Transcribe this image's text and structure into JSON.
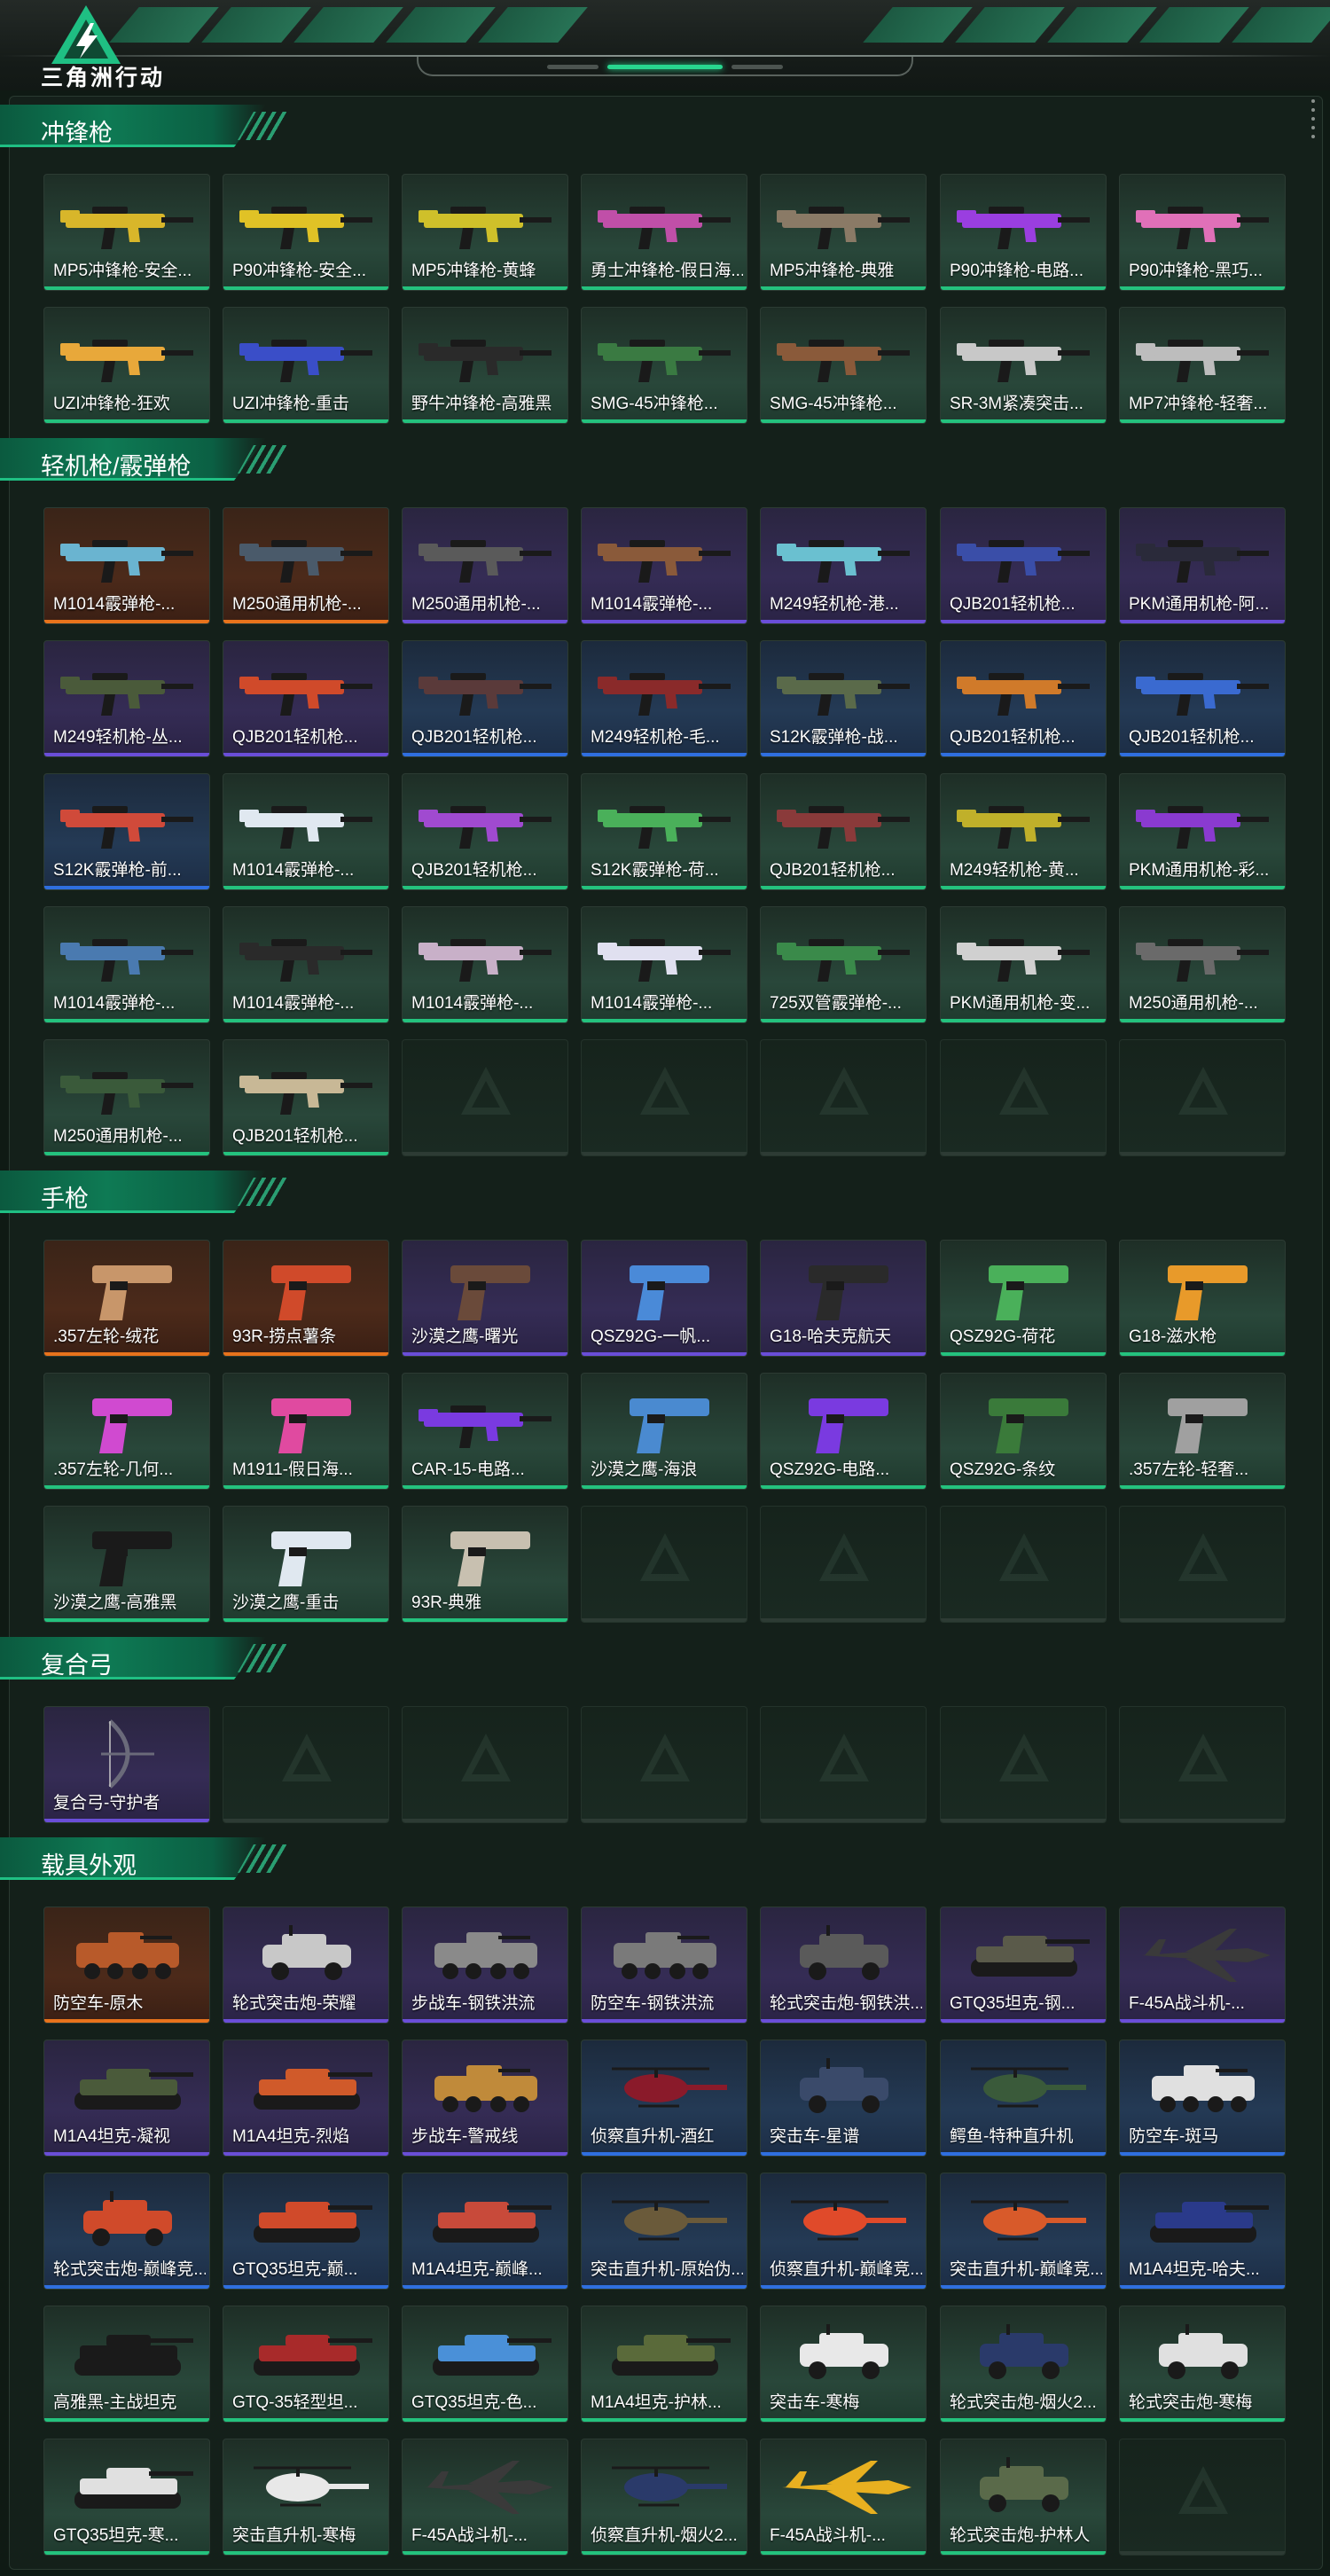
{
  "header": {
    "logo_text": "三角洲行动"
  },
  "sections": [
    {
      "title": "冲锋枪",
      "items": [
        {
          "label": "MP5冲锋枪-安全...",
          "rarity": "green",
          "kind": "gun",
          "color": "#d8b62a"
        },
        {
          "label": "P90冲锋枪-安全...",
          "rarity": "green",
          "kind": "gun",
          "color": "#e0c226"
        },
        {
          "label": "MP5冲锋枪-黄蜂",
          "rarity": "green",
          "kind": "gun",
          "color": "#cfc02a"
        },
        {
          "label": "勇士冲锋枪-假日海...",
          "rarity": "green",
          "kind": "gun",
          "color": "#c04fa8"
        },
        {
          "label": "MP5冲锋枪-典雅",
          "rarity": "green",
          "kind": "gun",
          "color": "#8a7a66"
        },
        {
          "label": "P90冲锋枪-电路...",
          "rarity": "green",
          "kind": "gun",
          "color": "#9a3ee0"
        },
        {
          "label": "P90冲锋枪-黑巧...",
          "rarity": "green",
          "kind": "gun",
          "color": "#e070b8"
        },
        {
          "label": "UZI冲锋枪-狂欢",
          "rarity": "green",
          "kind": "gun",
          "color": "#e8a83a"
        },
        {
          "label": "UZI冲锋枪-重击",
          "rarity": "green",
          "kind": "gun",
          "color": "#3a4ec8"
        },
        {
          "label": "野牛冲锋枪-高雅黑",
          "rarity": "green",
          "kind": "gun",
          "color": "#2a2a2a"
        },
        {
          "label": "SMG-45冲锋枪...",
          "rarity": "green",
          "kind": "gun",
          "color": "#3a7a42"
        },
        {
          "label": "SMG-45冲锋枪...",
          "rarity": "green",
          "kind": "gun",
          "color": "#8a5a3a"
        },
        {
          "label": "SR-3M紧凑突击...",
          "rarity": "green",
          "kind": "gun",
          "color": "#c8c8c8"
        },
        {
          "label": "MP7冲锋枪-轻奢...",
          "rarity": "green",
          "kind": "gun",
          "color": "#bdbdbd"
        }
      ]
    },
    {
      "title": "轻机枪/霰弹枪",
      "items": [
        {
          "label": "M1014霰弹枪-...",
          "rarity": "orange",
          "kind": "gun",
          "color": "#6ab4d0"
        },
        {
          "label": "M250通用机枪-...",
          "rarity": "orange",
          "kind": "gun",
          "color": "#4a5a6a"
        },
        {
          "label": "M250通用机枪-...",
          "rarity": "purple",
          "kind": "gun",
          "color": "#5a5a5a"
        },
        {
          "label": "M1014霰弹枪-...",
          "rarity": "purple",
          "kind": "gun",
          "color": "#8a5a3a"
        },
        {
          "label": "M249轻机枪-港...",
          "rarity": "purple",
          "kind": "gun",
          "color": "#6ac0d0"
        },
        {
          "label": "QJB201轻机枪...",
          "rarity": "purple",
          "kind": "gun",
          "color": "#3a4ea8"
        },
        {
          "label": "PKM通用机枪-阿...",
          "rarity": "purple",
          "kind": "gun",
          "color": "#2a2a3a"
        },
        {
          "label": "M249轻机枪-丛...",
          "rarity": "purple",
          "kind": "gun",
          "color": "#4a5a3a"
        },
        {
          "label": "QJB201轻机枪...",
          "rarity": "purple",
          "kind": "gun",
          "color": "#d04a2a"
        },
        {
          "label": "QJB201轻机枪...",
          "rarity": "blue",
          "kind": "gun",
          "color": "#5a3a3a"
        },
        {
          "label": "M249轻机枪-毛...",
          "rarity": "blue",
          "kind": "gun",
          "color": "#8a2a2a"
        },
        {
          "label": "S12K霰弹枪-战...",
          "rarity": "blue",
          "kind": "gun",
          "color": "#5a6a4a"
        },
        {
          "label": "QJB201轻机枪...",
          "rarity": "blue",
          "kind": "gun",
          "color": "#d07a2a"
        },
        {
          "label": "QJB201轻机枪...",
          "rarity": "blue",
          "kind": "gun",
          "color": "#3a6ad0"
        },
        {
          "label": "S12K霰弹枪-前...",
          "rarity": "blue",
          "kind": "gun",
          "color": "#d04a3a"
        },
        {
          "label": "M1014霰弹枪-...",
          "rarity": "green",
          "kind": "gun",
          "color": "#e0e8f0"
        },
        {
          "label": "QJB201轻机枪...",
          "rarity": "green",
          "kind": "gun",
          "color": "#a04ad0"
        },
        {
          "label": "S12K霰弹枪-荷...",
          "rarity": "green",
          "kind": "gun",
          "color": "#4ab05a"
        },
        {
          "label": "QJB201轻机枪...",
          "rarity": "green",
          "kind": "gun",
          "color": "#8a3a3a"
        },
        {
          "label": "M249轻机枪-黄...",
          "rarity": "green",
          "kind": "gun",
          "color": "#c0b02a"
        },
        {
          "label": "PKM通用机枪-彩...",
          "rarity": "green",
          "kind": "gun",
          "color": "#8a3ad0"
        },
        {
          "label": "M1014霰弹枪-...",
          "rarity": "green",
          "kind": "gun",
          "color": "#4a7ab0"
        },
        {
          "label": "M1014霰弹枪-...",
          "rarity": "green",
          "kind": "gun",
          "color": "#2a2a2a"
        },
        {
          "label": "M1014霰弹枪-...",
          "rarity": "green",
          "kind": "gun",
          "color": "#c8b0c8"
        },
        {
          "label": "M1014霰弹枪-...",
          "rarity": "green",
          "kind": "gun",
          "color": "#e0e0f0"
        },
        {
          "label": "725双管霰弹枪-...",
          "rarity": "green",
          "kind": "gun",
          "color": "#3a8a4a"
        },
        {
          "label": "PKM通用机枪-变...",
          "rarity": "green",
          "kind": "gun",
          "color": "#d0d0d0"
        },
        {
          "label": "M250通用机枪-...",
          "rarity": "green",
          "kind": "gun",
          "color": "#6a6a6a"
        },
        {
          "label": "M250通用机枪-...",
          "rarity": "green",
          "kind": "gun",
          "color": "#3a5a3a"
        },
        {
          "label": "QJB201轻机枪...",
          "rarity": "green",
          "kind": "gun",
          "color": "#c8b896"
        },
        {
          "label": "",
          "rarity": "empty",
          "kind": "none"
        },
        {
          "label": "",
          "rarity": "empty",
          "kind": "none"
        },
        {
          "label": "",
          "rarity": "empty",
          "kind": "none"
        },
        {
          "label": "",
          "rarity": "empty",
          "kind": "none"
        },
        {
          "label": "",
          "rarity": "empty",
          "kind": "none"
        }
      ]
    },
    {
      "title": "手枪",
      "items": [
        {
          "label": ".357左轮-绒花",
          "rarity": "orange",
          "kind": "pistol",
          "color": "#c8966a"
        },
        {
          "label": "93R-捞点薯条",
          "rarity": "orange",
          "kind": "pistol",
          "color": "#d04a2a"
        },
        {
          "label": "沙漠之鹰-曙光",
          "rarity": "purple",
          "kind": "pistol",
          "color": "#6a4a3a"
        },
        {
          "label": "QSZ92G-一帆...",
          "rarity": "purple",
          "kind": "pistol",
          "color": "#4a8ad8"
        },
        {
          "label": "G18-哈夫克航天",
          "rarity": "purple",
          "kind": "pistol",
          "color": "#2a2a2a"
        },
        {
          "label": "QSZ92G-荷花",
          "rarity": "green",
          "kind": "pistol",
          "color": "#4ab05a"
        },
        {
          "label": "G18-滋水枪",
          "rarity": "green",
          "kind": "pistol",
          "color": "#e89a2a"
        },
        {
          "label": ".357左轮-几何...",
          "rarity": "green",
          "kind": "pistol",
          "color": "#d04ad0"
        },
        {
          "label": "M1911-假日海...",
          "rarity": "green",
          "kind": "pistol",
          "color": "#e04aa0"
        },
        {
          "label": "CAR-15-电路...",
          "rarity": "green",
          "kind": "gun",
          "color": "#7a3ae0"
        },
        {
          "label": "沙漠之鹰-海浪",
          "rarity": "green",
          "kind": "pistol",
          "color": "#4a8ad0"
        },
        {
          "label": "QSZ92G-电路...",
          "rarity": "green",
          "kind": "pistol",
          "color": "#7a3ae0"
        },
        {
          "label": "QSZ92G-条纹",
          "rarity": "green",
          "kind": "pistol",
          "color": "#3a7a3a"
        },
        {
          "label": ".357左轮-轻奢...",
          "rarity": "green",
          "kind": "pistol",
          "color": "#a0a0a0"
        },
        {
          "label": "沙漠之鹰-高雅黑",
          "rarity": "green",
          "kind": "pistol",
          "color": "#1a1a1a"
        },
        {
          "label": "沙漠之鹰-重击",
          "rarity": "green",
          "kind": "pistol",
          "color": "#e0e8f0"
        },
        {
          "label": "93R-典雅",
          "rarity": "green",
          "kind": "pistol",
          "color": "#c8c0b0"
        },
        {
          "label": "",
          "rarity": "empty",
          "kind": "none"
        },
        {
          "label": "",
          "rarity": "empty",
          "kind": "none"
        },
        {
          "label": "",
          "rarity": "empty",
          "kind": "none"
        },
        {
          "label": "",
          "rarity": "empty",
          "kind": "none"
        }
      ]
    },
    {
      "title": "复合弓",
      "items": [
        {
          "label": "复合弓-守护者",
          "rarity": "purple",
          "kind": "bow",
          "color": "#6a6a7a"
        },
        {
          "label": "",
          "rarity": "empty",
          "kind": "none"
        },
        {
          "label": "",
          "rarity": "empty",
          "kind": "none"
        },
        {
          "label": "",
          "rarity": "empty",
          "kind": "none"
        },
        {
          "label": "",
          "rarity": "empty",
          "kind": "none"
        },
        {
          "label": "",
          "rarity": "empty",
          "kind": "none"
        },
        {
          "label": "",
          "rarity": "empty",
          "kind": "none"
        }
      ]
    },
    {
      "title": "载具外观",
      "items": [
        {
          "label": "防空车-原木",
          "rarity": "orange",
          "kind": "apc",
          "color": "#b85a2a"
        },
        {
          "label": "轮式突击炮-荣耀",
          "rarity": "purple",
          "kind": "car",
          "color": "#c8c8c8"
        },
        {
          "label": "步战车-钢铁洪流",
          "rarity": "purple",
          "kind": "apc",
          "color": "#8a8a8a"
        },
        {
          "label": "防空车-钢铁洪流",
          "rarity": "purple",
          "kind": "apc",
          "color": "#7a7a7a"
        },
        {
          "label": "轮式突击炮-钢铁洪...",
          "rarity": "purple",
          "kind": "car",
          "color": "#5a5a5a"
        },
        {
          "label": "GTQ35坦克-钢...",
          "rarity": "purple",
          "kind": "tank",
          "color": "#5a5a4a"
        },
        {
          "label": "F-45A战斗机-...",
          "rarity": "purple",
          "kind": "jet",
          "color": "#3a3a3a"
        },
        {
          "label": "M1A4坦克-凝视",
          "rarity": "purple",
          "kind": "tank",
          "color": "#4a5a3a"
        },
        {
          "label": "M1A4坦克-烈焰",
          "rarity": "purple",
          "kind": "tank",
          "color": "#d05a2a"
        },
        {
          "label": "步战车-警戒线",
          "rarity": "purple",
          "kind": "apc",
          "color": "#c08a3a"
        },
        {
          "label": "侦察直升机-酒红",
          "rarity": "blue",
          "kind": "heli",
          "color": "#8a1a2a"
        },
        {
          "label": "突击车-星谱",
          "rarity": "blue",
          "kind": "car",
          "color": "#3a4a6a"
        },
        {
          "label": "鳄鱼-特种直升机",
          "rarity": "blue",
          "kind": "heli",
          "color": "#3a5a3a"
        },
        {
          "label": "防空车-斑马",
          "rarity": "blue",
          "kind": "apc",
          "color": "#e0e0e0"
        },
        {
          "label": "轮式突击炮-巅峰竞...",
          "rarity": "blue",
          "kind": "car",
          "color": "#d04a2a"
        },
        {
          "label": "GTQ35坦克-巅...",
          "rarity": "blue",
          "kind": "tank",
          "color": "#d04a2a"
        },
        {
          "label": "M1A4坦克-巅峰...",
          "rarity": "blue",
          "kind": "tank",
          "color": "#c84a3a"
        },
        {
          "label": "突击直升机-原始伪...",
          "rarity": "blue",
          "kind": "heli",
          "color": "#6a5a3a"
        },
        {
          "label": "侦察直升机-巅峰竞...",
          "rarity": "blue",
          "kind": "heli",
          "color": "#e04a2a"
        },
        {
          "label": "突击直升机-巅峰竞...",
          "rarity": "blue",
          "kind": "heli",
          "color": "#d85a2a"
        },
        {
          "label": "M1A4坦克-哈夫...",
          "rarity": "blue",
          "kind": "tank",
          "color": "#2a3a8a"
        },
        {
          "label": "高雅黑-主战坦克",
          "rarity": "green",
          "kind": "tank",
          "color": "#1a1a1a"
        },
        {
          "label": "GTQ-35轻型坦...",
          "rarity": "green",
          "kind": "tank",
          "color": "#a82a2a"
        },
        {
          "label": "GTQ35坦克-色...",
          "rarity": "green",
          "kind": "tank",
          "color": "#4a90d8"
        },
        {
          "label": "M1A4坦克-护林...",
          "rarity": "green",
          "kind": "tank",
          "color": "#5a6a3a"
        },
        {
          "label": "突击车-寒梅",
          "rarity": "green",
          "kind": "car",
          "color": "#e8e8e8"
        },
        {
          "label": "轮式突击炮-烟火2...",
          "rarity": "green",
          "kind": "car",
          "color": "#2a3a6a"
        },
        {
          "label": "轮式突击炮-寒梅",
          "rarity": "green",
          "kind": "car",
          "color": "#e0e0e0"
        },
        {
          "label": "GTQ35坦克-寒...",
          "rarity": "green",
          "kind": "tank",
          "color": "#e0e0e0"
        },
        {
          "label": "突击直升机-寒梅",
          "rarity": "green",
          "kind": "heli",
          "color": "#e8e8e8"
        },
        {
          "label": "F-45A战斗机-...",
          "rarity": "green",
          "kind": "jet",
          "color": "#3a3a3a"
        },
        {
          "label": "侦察直升机-烟火2...",
          "rarity": "green",
          "kind": "heli",
          "color": "#2a3a6a"
        },
        {
          "label": "F-45A战斗机-...",
          "rarity": "green",
          "kind": "jet",
          "color": "#e8b020"
        },
        {
          "label": "轮式突击炮-护林人",
          "rarity": "green",
          "kind": "car",
          "color": "#5a6a4a"
        },
        {
          "label": "",
          "rarity": "empty",
          "kind": "none"
        }
      ]
    }
  ]
}
